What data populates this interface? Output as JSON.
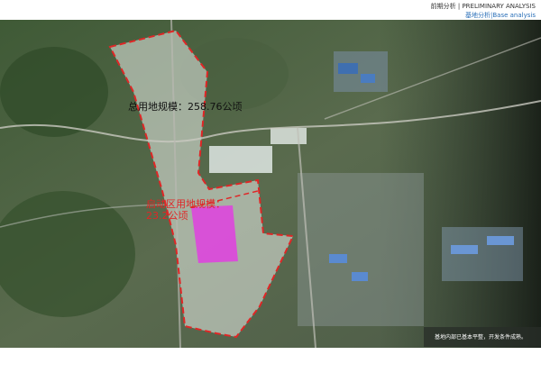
{
  "header": {
    "title": "前期分析 | PRELIMINARY ANALYSIS",
    "subtitle": "基地分析|Base analysis"
  },
  "map": {
    "total_area_label": "总用地规模：258.76公顷",
    "start_area_label_line1": "启动区用地规模：",
    "start_area_label_line2": "23.2公顷",
    "note": "基地内部已基本平整，开发条件成熟。"
  },
  "colors": {
    "boundary": "#e02626",
    "start_zone": "#e040e0",
    "label_red": "#e02626",
    "header_blue": "#2a6fb8"
  }
}
